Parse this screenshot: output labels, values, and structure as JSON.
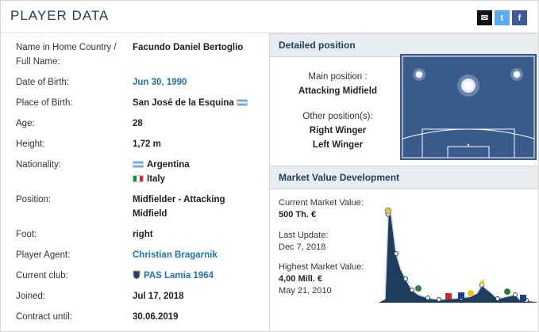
{
  "header": {
    "title": "PLAYER DATA",
    "share": [
      "mail-icon",
      "twitter-icon",
      "facebook-icon"
    ]
  },
  "player": {
    "rows": [
      {
        "label": "Name in Home Country / Full Name:",
        "value": "Facundo Daniel Bertoglio"
      },
      {
        "label": "Date of Birth:",
        "value": "Jun 30, 1990"
      },
      {
        "label": "Place of Birth:",
        "value": "San José de la Esquina"
      },
      {
        "label": "Age:",
        "value": "28"
      },
      {
        "label": "Height:",
        "value": "1,72 m"
      },
      {
        "label": "Nationality:",
        "value": "Argentina",
        "value2": "Italy"
      },
      {
        "label": "Position:",
        "value": "Midfielder - Attacking Midfield"
      },
      {
        "label": "Foot:",
        "value": "right"
      },
      {
        "label": "Player Agent:",
        "value": "Christian Bragarnik"
      },
      {
        "label": "Current club:",
        "value": "PAS Lamia 1964"
      },
      {
        "label": "Joined:",
        "value": "Jul 17, 2018"
      },
      {
        "label": "Contract until:",
        "value": "30.06.2019"
      }
    ]
  },
  "position": {
    "heading": "Detailed position",
    "main_label": "Main position :",
    "main_value": "Attacking Midfield",
    "other_label": "Other position(s):",
    "other_values": [
      "Right Winger",
      "Left Winger"
    ],
    "pitch_color": "#3a5a8c"
  },
  "market": {
    "heading": "Market Value Development",
    "current_label": "Current Market Value:",
    "current_value": "500 Th. €",
    "update_label": "Last Update:",
    "update_value": "Dec 7, 2018",
    "highest_label": "Highest Market Value:",
    "highest_value": "4,00 Mill. €",
    "highest_date": "May 21, 2010",
    "area_color": "#1d3c5e"
  }
}
